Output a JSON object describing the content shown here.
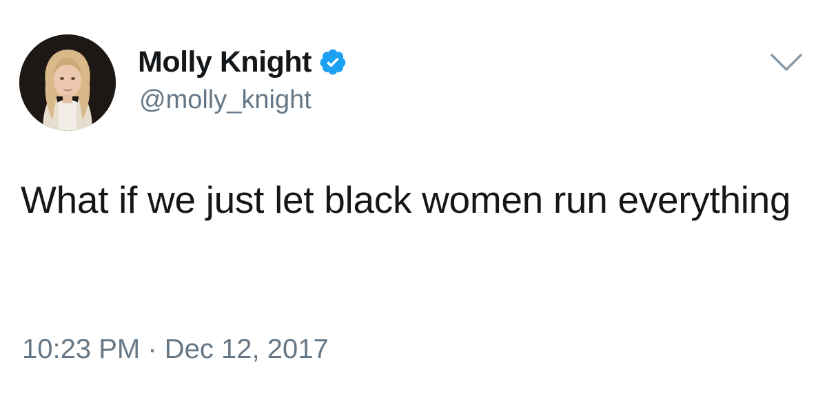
{
  "tweet": {
    "display_name": "Molly Knight",
    "handle": "@molly_knight",
    "verified": true,
    "text": "What if we just let black women run everything",
    "timestamp": "10:23 PM · Dec 12, 2017"
  },
  "icons": {
    "avatar": "profile-photo",
    "verified": "verified-badge-icon",
    "menu": "chevron-down-icon"
  },
  "colors": {
    "verified_blue": "#1da1f2",
    "secondary_text": "#657786",
    "primary_text": "#14171a",
    "caret": "#8899a6"
  }
}
